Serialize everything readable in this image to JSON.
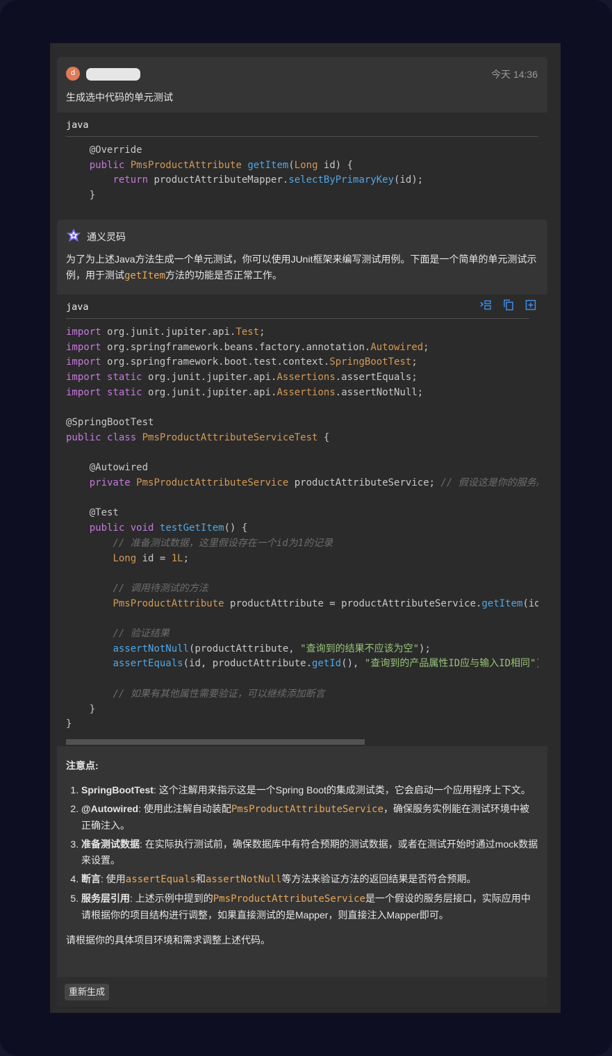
{
  "user_message": {
    "avatar_letter": "d",
    "timestamp": "今天 14:36",
    "text": "生成选中代码的单元测试",
    "code_lang": "java"
  },
  "ai_message": {
    "assistant_name": "通义灵码",
    "intro_prefix": "为了为上述Java方法生成一个单元测试，你可以使用JUnit框架来编写测试用例。下面是一个简单的单元测试示例，用于测试",
    "intro_code": "getItem",
    "intro_suffix": "方法的功能是否正常工作。",
    "code_lang": "java",
    "code_tools": [
      "insert-icon",
      "copy-icon",
      "new-file-icon"
    ],
    "horizontal_scroll_position": 0.0,
    "notes_title": "注意点:",
    "notes": [
      {
        "bold": "SpringBootTest",
        "text": ": 这个注解用来指示这是一个Spring Boot的集成测试类，它会启动一个应用程序上下文。"
      },
      {
        "bold": "@Autowired",
        "text": ": 使用此注解自动装配",
        "code": "PmsProductAttributeService",
        "text2": "，确保服务实例能在测试环境中被正确注入。"
      },
      {
        "bold": "准备测试数据",
        "text": ": 在实际执行测试前，确保数据库中有符合预期的测试数据，或者在测试开始时通过mock数据来设置。"
      },
      {
        "bold": "断言",
        "text": ": 使用",
        "code": "assertEquals",
        "text2": "和",
        "code2": "assertNotNull",
        "text3": "等方法来验证方法的返回结果是否符合预期。"
      },
      {
        "bold": "服务层引用",
        "text": ": 上述示例中提到的",
        "code": "PmsProductAttributeService",
        "text2": "是一个假设的服务层接口，实际应用中请根据你的项目结构进行调整，如果直接测试的是Mapper，则直接注入Mapper即可。"
      }
    ],
    "closing": "请根据你的具体项目环境和需求调整上述代码。",
    "regenerate_label": "重新生成"
  },
  "colors": {
    "background": "#16172d",
    "panel": "#2b2b2b",
    "card": "#353535",
    "keyword": "#c678dd",
    "type": "#d39a55",
    "function": "#4fa7e7",
    "string": "#98c379",
    "comment": "#6d6d6d",
    "tool_icon": "#3d8ee8"
  }
}
